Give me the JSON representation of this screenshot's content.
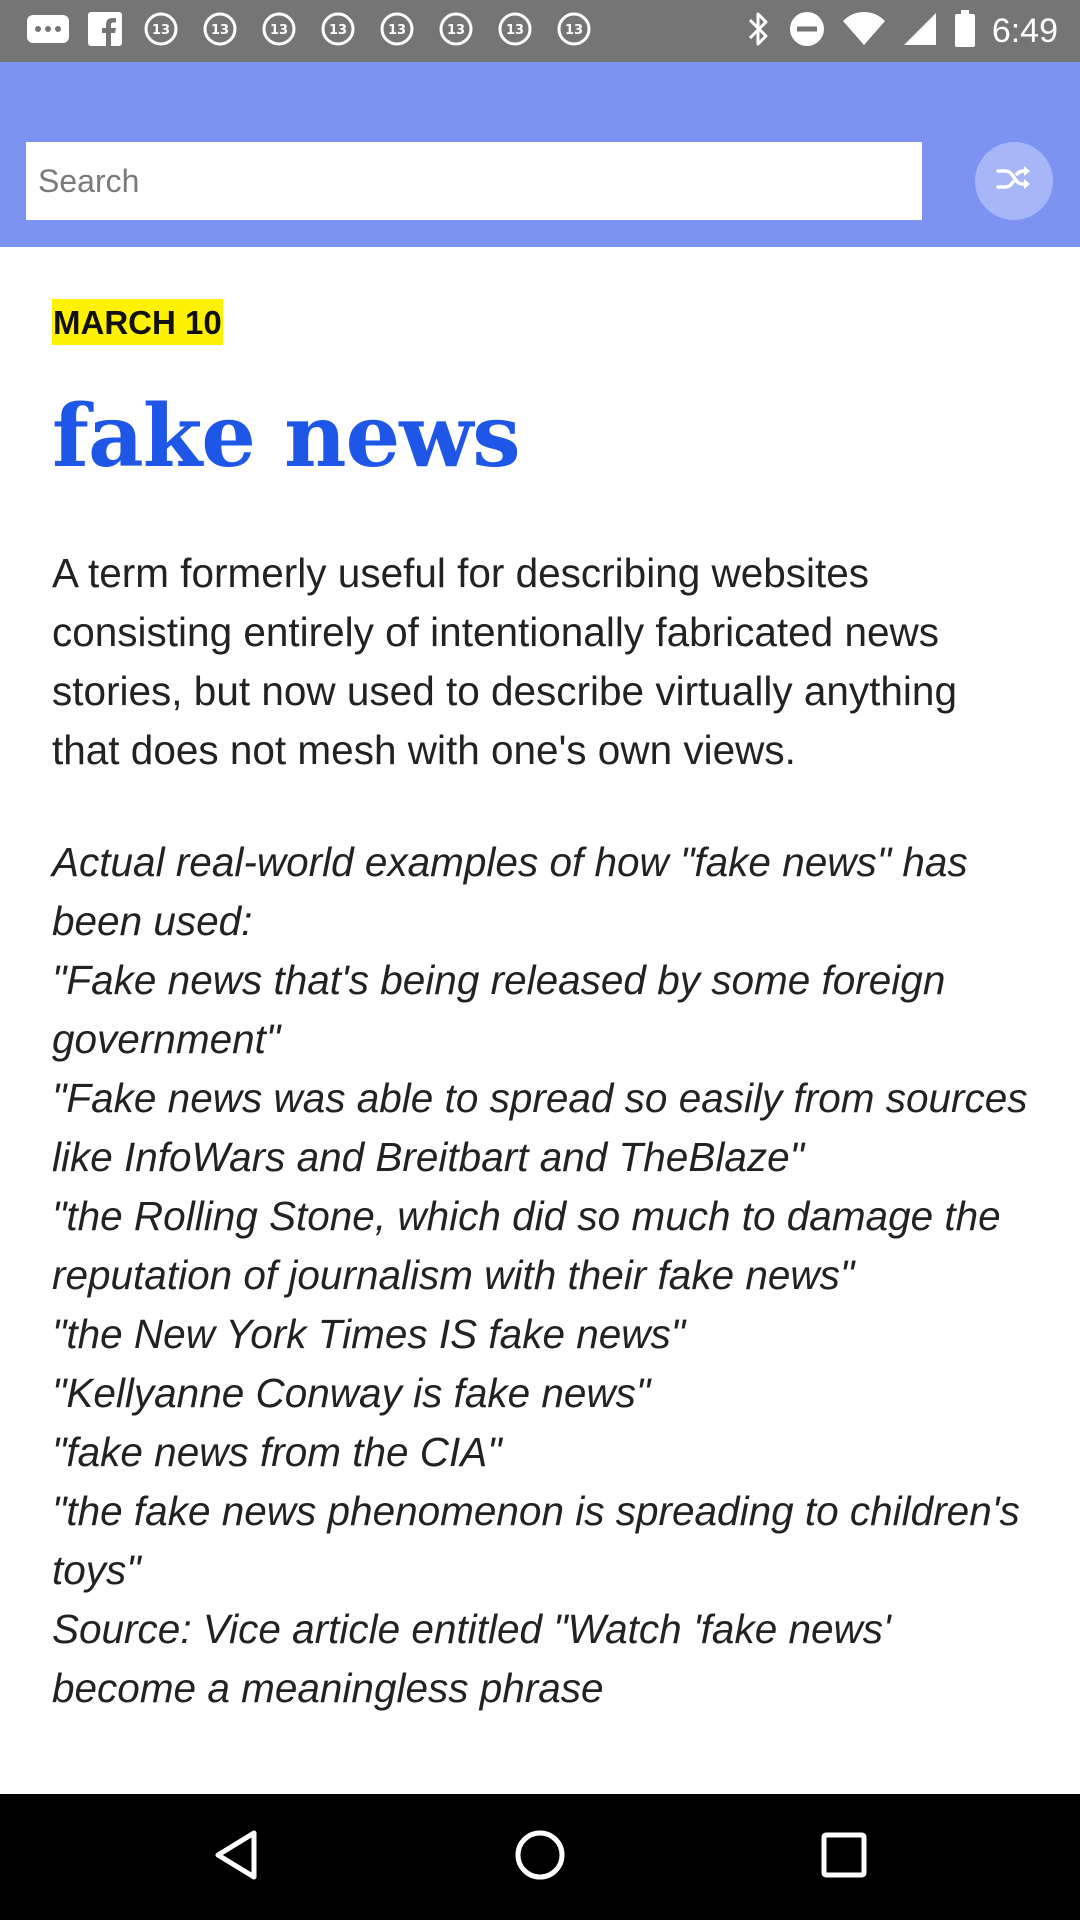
{
  "status_bar": {
    "time": "6:49",
    "notification_icons": [
      "more-icon",
      "facebook-icon",
      "abc13-icon",
      "abc13-icon",
      "abc13-icon",
      "abc13-icon",
      "abc13-icon",
      "abc13-icon",
      "abc13-icon",
      "abc13-icon"
    ],
    "system_icons": [
      "bluetooth-icon",
      "do-not-disturb-icon",
      "wifi-icon",
      "signal-icon",
      "battery-icon"
    ]
  },
  "header": {
    "search_placeholder": "Search",
    "shuffle_icon": "shuffle-icon",
    "background_color": "#7c93f2"
  },
  "entry": {
    "date": "MARCH 10",
    "word": "fake news",
    "definition": "A term formerly useful for describing websites consisting entirely of intentionally fabricated news stories, but now used to describe virtually anything that does not mesh with one's own views.",
    "examples": [
      "Actual real-world examples of how \"fake news\" has been used:",
      "\"Fake news that's being released by some foreign government\"",
      "\"Fake news was able to spread so easily from sources like InfoWars and Breitbart and TheBlaze\"",
      "\"the Rolling Stone, which did so much to damage the reputation of journalism with their fake news\"",
      "\"the New York Times IS fake news\"",
      "\"Kellyanne Conway is fake news\"",
      "\"fake news from the CIA\"",
      "\"the fake news phenomenon is spreading to children's toys\"",
      "Source: Vice article entitled \"Watch 'fake news' become a meaningless phrase"
    ],
    "title_color": "#1e56e8",
    "date_highlight_color": "#fff200"
  },
  "nav_bar": {
    "buttons": [
      "back-icon",
      "home-icon",
      "recents-icon"
    ]
  }
}
